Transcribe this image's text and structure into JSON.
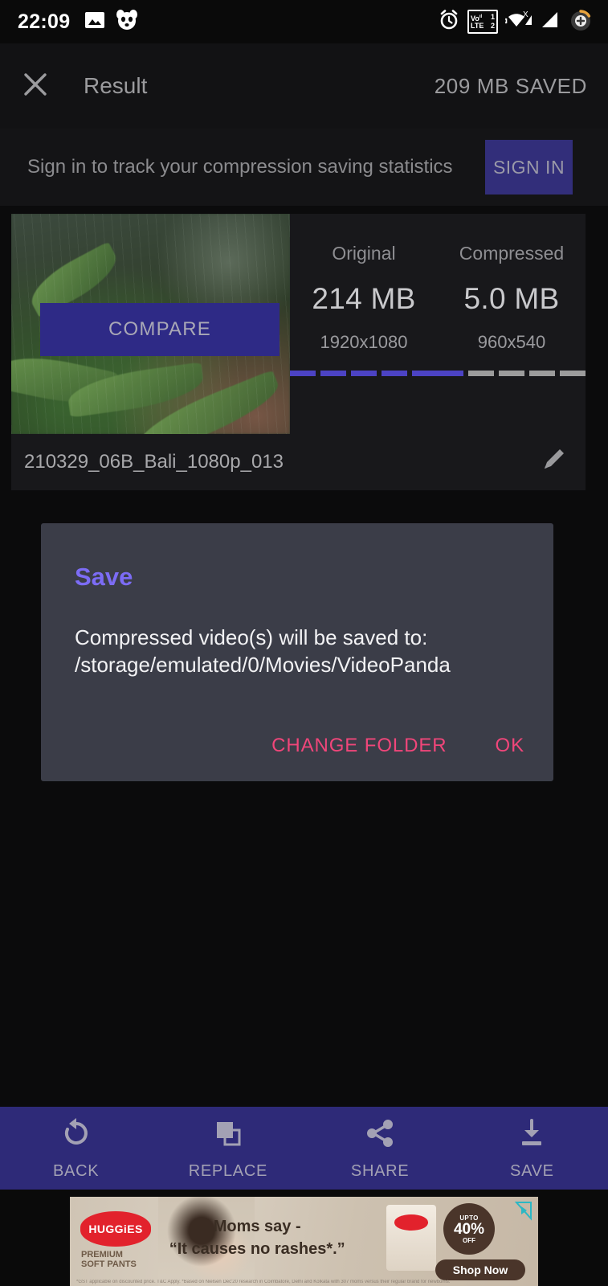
{
  "status_bar": {
    "time": "22:09",
    "left_icons": [
      "image-icon",
      "panda-app-icon"
    ],
    "right_icons": [
      "alarm-icon",
      "volte-dual-sim-icon",
      "wifi-no-internet-icon",
      "signal-1-icon",
      "signal-2-icon",
      "battery-charging-icon"
    ],
    "volte": {
      "label": "VoLTE",
      "sim1": "1",
      "sim2": "2"
    }
  },
  "app_bar": {
    "close_icon": "close-icon",
    "title": "Result",
    "saved_label": "209 MB SAVED"
  },
  "signin_banner": {
    "message": "Sign in to track your compression saving statistics",
    "button_label": "SIGN IN"
  },
  "result_card": {
    "compare_button": "COMPARE",
    "filename": "210329_06B_Bali_1080p_013",
    "edit_icon": "pencil-icon",
    "original": {
      "label": "Original",
      "size": "214 MB",
      "resolution": "1920x1080",
      "segments_total": 5,
      "segments_filled": 5
    },
    "compressed": {
      "label": "Compressed",
      "size": "5.0 MB",
      "resolution": "960x540",
      "segments_total": 5,
      "segments_filled": 1
    }
  },
  "save_dialog": {
    "title": "Save",
    "message": "Compressed video(s) will be saved to: /storage/emulated/0/Movies/VideoPanda",
    "change_folder_label": "CHANGE FOLDER",
    "ok_label": "OK"
  },
  "bottom_nav": [
    {
      "icon": "rotate-back-icon",
      "label": "BACK"
    },
    {
      "icon": "copy-replace-icon",
      "label": "REPLACE"
    },
    {
      "icon": "share-icon",
      "label": "SHARE"
    },
    {
      "icon": "download-save-icon",
      "label": "SAVE"
    }
  ],
  "ad": {
    "brand": "HUGGiES",
    "brand_sub_line1": "PREMIUM",
    "brand_sub_line2": "SOFT PANTS",
    "headline_line1": "Moms say -",
    "headline_line2": "“It causes no rashes*.”",
    "badge_upto": "UPTO",
    "badge_percent": "40%",
    "badge_off": "OFF",
    "cta": "Shop Now",
    "adchoices_icon": "adchoices-icon",
    "fine_print": "*GST applicable on discounted price. T&C Apply. *Based on Nielsen Dec'20 research in Coimbatore, Delhi and Kolkata with 307 moms versus their regular brand for newborns."
  },
  "colors": {
    "accent_purple": "#2e2a78",
    "dialog_title": "#7c6cf5",
    "dialog_action": "#f0467a",
    "segment_filled": "#4c43c4",
    "segment_empty": "#9c9c9c"
  }
}
